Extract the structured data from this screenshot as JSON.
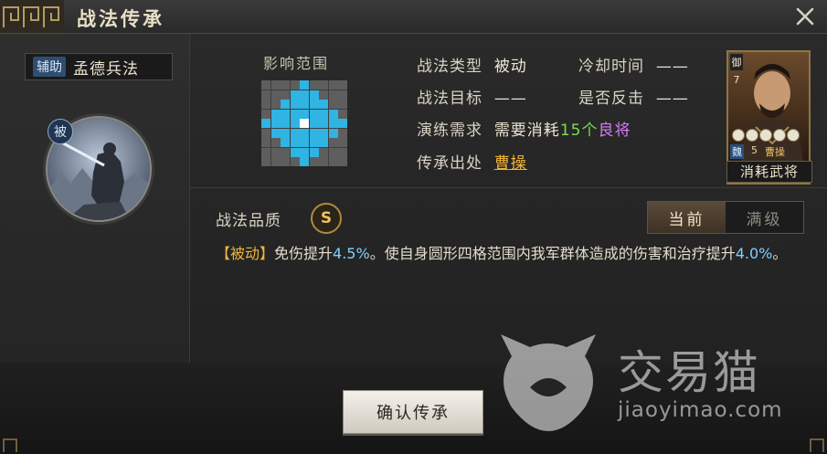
{
  "window": {
    "title": "战法传承",
    "close_glyph": "✕"
  },
  "skill": {
    "tag": "辅助",
    "name": "孟德兵法",
    "passive_badge": "被"
  },
  "range": {
    "title": "影响范围",
    "grid_size": 9,
    "radius": 4
  },
  "info": {
    "type_label": "战法类型",
    "type_value": "被动",
    "cooldown_label": "冷却时间",
    "cooldown_value": "——",
    "target_label": "战法目标",
    "target_value": "——",
    "counter_label": "是否反击",
    "counter_value": "——",
    "requirement_label": "演练需求",
    "requirement_prefix": "需要消耗",
    "requirement_count": "15个",
    "requirement_suffix": "良将",
    "origin_label": "传承出处",
    "origin_value": "曹操"
  },
  "general_card": {
    "faction": "魏",
    "cost": "5",
    "name": "曹操",
    "type_glyph": "御",
    "level": "7",
    "stars": 5,
    "label": "消耗武将"
  },
  "quality": {
    "label": "战法品质",
    "grade": "S"
  },
  "toggle": {
    "current": "当前",
    "max": "满级"
  },
  "description": {
    "tag": "【被动】",
    "part1": "免伤提升",
    "value1": "4.5%",
    "part2": "。使自身圆形四格范围内我军群体造成的伤害和治疗提升",
    "value2": "4.0%",
    "part3": "。"
  },
  "confirm_button": "确认传承",
  "watermark": {
    "brand": "交易猫",
    "url": "jiaoyimao.com"
  },
  "colors": {
    "range_on": "#2fb4e3",
    "range_center": "#ffffff",
    "highlight_gold": "#f0b43a",
    "highlight_green": "#7ed957",
    "highlight_purple": "#d67cf7"
  }
}
